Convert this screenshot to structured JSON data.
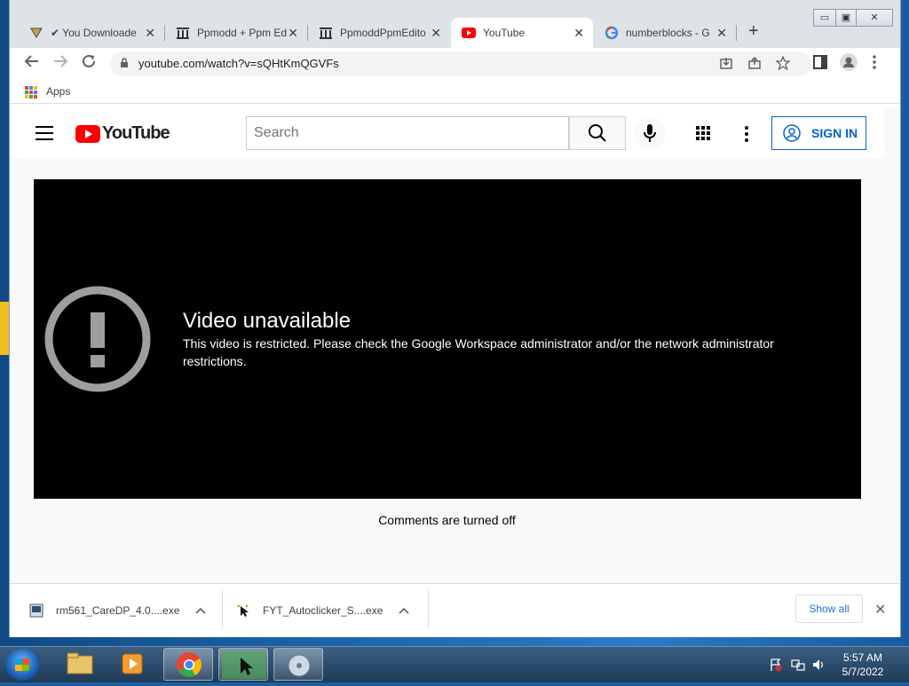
{
  "tabs": [
    {
      "title": "✔ You Downloade",
      "icon": "download-check-icon"
    },
    {
      "title": "Ppmodd + Ppm Ed",
      "icon": "museum-icon"
    },
    {
      "title": "PpmoddPpmEdito",
      "icon": "museum-icon"
    },
    {
      "title": "YouTube",
      "icon": "youtube-icon"
    },
    {
      "title": "numberblocks - G",
      "icon": "google-icon"
    }
  ],
  "toolbar": {
    "url": "youtube.com/watch?v=sQHtKmQGVFs"
  },
  "bookmarks": {
    "apps_label": "Apps"
  },
  "youtube": {
    "logo_text": "YouTube",
    "search_placeholder": "Search",
    "sign_in_label": "SIGN IN"
  },
  "player": {
    "title": "Video unavailable",
    "message": "This video is restricted. Please check the Google Workspace administrator and/or the network administrator restrictions."
  },
  "comments": {
    "text": "Comments are turned off"
  },
  "downloads": {
    "items": [
      {
        "name": "rm561_CareDP_4.0....exe"
      },
      {
        "name": "FYT_Autoclicker_S....exe"
      }
    ],
    "show_all_label": "Show all"
  },
  "taskbar": {
    "time": "5:57 AM",
    "date": "5/7/2022"
  },
  "colors": {
    "youtube_red": "#ff0000",
    "sign_in_blue": "#065fd4",
    "player_bg": "#000000"
  }
}
